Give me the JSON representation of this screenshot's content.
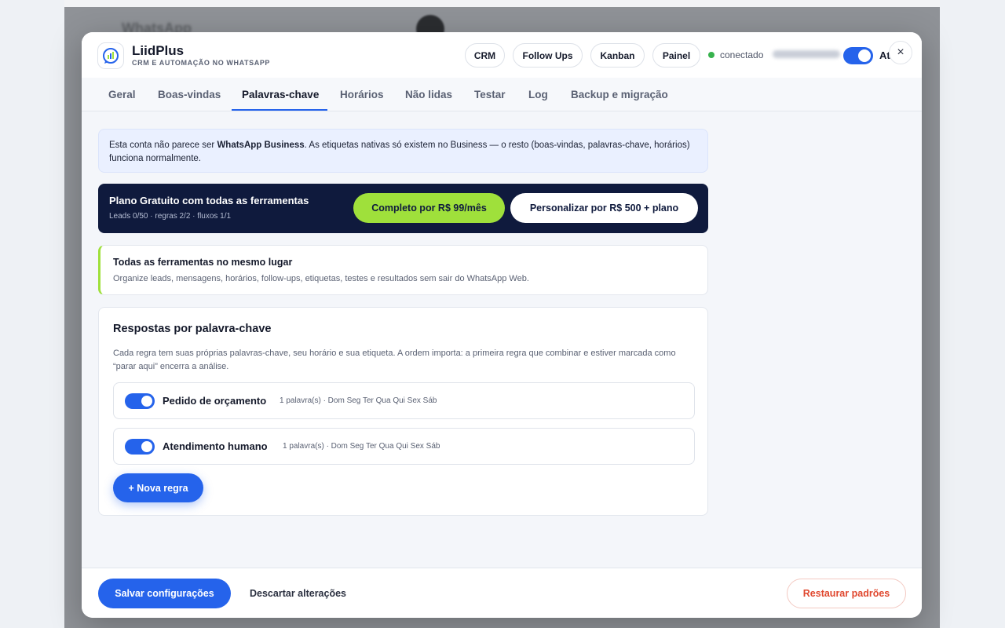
{
  "background": {
    "app_title": "WhatsApp"
  },
  "header": {
    "brand_name": "LiidPlus",
    "brand_subtitle": "CRM E AUTOMAÇÃO NO WHATSAPP",
    "nav": [
      "CRM",
      "Follow Ups",
      "Kanban",
      "Painel"
    ],
    "status": "conectado",
    "toggle_label": "At",
    "toggle_on": true,
    "close_icon": "×"
  },
  "tabs": [
    {
      "label": "Geral",
      "active": false
    },
    {
      "label": "Boas-vindas",
      "active": false
    },
    {
      "label": "Palavras-chave",
      "active": true
    },
    {
      "label": "Horários",
      "active": false
    },
    {
      "label": "Não lidas",
      "active": false
    },
    {
      "label": "Testar",
      "active": false
    },
    {
      "label": "Log",
      "active": false
    },
    {
      "label": "Backup e migração",
      "active": false
    }
  ],
  "info_banner": {
    "prefix": "Esta conta não parece ser ",
    "bold": "WhatsApp Business",
    "suffix": ". As etiquetas nativas só existem no Business — o resto (boas-vindas, palavras-chave, horários) funciona normalmente."
  },
  "plan": {
    "title": "Plano Gratuito com todas as ferramentas",
    "usage": "Leads 0/50 · regras 2/2 · fluxos 1/1",
    "complete_button": "Completo por R$ 99/mês",
    "custom_button": "Personalizar por R$ 500 + plano"
  },
  "tools_card": {
    "title": "Todas as ferramentas no mesmo lugar",
    "subtitle": "Organize leads, mensagens, horários, follow-ups, etiquetas, testes e resultados sem sair do WhatsApp Web."
  },
  "keywords": {
    "title": "Respostas por palavra-chave",
    "description": "Cada regra tem suas próprias palavras-chave, seu horário e sua etiqueta. A ordem importa: a primeira regra que combinar e estiver marcada como “parar aqui” encerra a análise.",
    "rules": [
      {
        "name": "Pedido de orçamento",
        "meta": "1 palavra(s) · Dom Seg Ter Qua Qui Sex Sáb",
        "enabled": true
      },
      {
        "name": "Atendimento humano",
        "meta": "1 palavra(s) · Dom Seg Ter Qua Qui Sex Sáb",
        "enabled": true
      }
    ],
    "new_rule_button": "+ Nova regra"
  },
  "footer": {
    "save_button": "Salvar configurações",
    "discard_button": "Descartar alterações",
    "restore_button": "Restaurar padrões"
  },
  "colors": {
    "accent": "#2563eb",
    "navy": "#0f1a3d",
    "lime": "#9fe03b",
    "danger": "#e0482f",
    "status_green": "#37b24d"
  }
}
